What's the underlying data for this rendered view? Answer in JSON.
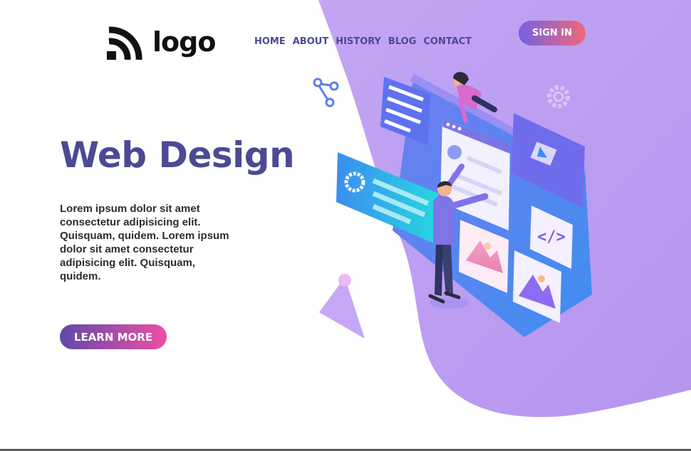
{
  "logo": {
    "text": "logo",
    "icon": "rss-arcs-icon"
  },
  "nav": {
    "items": [
      "HOME",
      "ABOUT",
      "HISTORY",
      "BLOG",
      "CONTACT"
    ]
  },
  "header": {
    "signin_label": "SIGN IN"
  },
  "hero": {
    "title": "Web Design",
    "body": "Lorem ipsum dolor sit amet consectetur adipisicing elit. Quisquam, quidem. Lorem ipsum dolor sit amet consectetur adipisicing elit. Quisquam, quidem.",
    "cta_label": "LEARN MORE"
  },
  "colors": {
    "accent": "#4b4a93",
    "purple_bg": "#c9a6f2",
    "signin_gradient": [
      "#7561e4",
      "#f0687a"
    ],
    "cta_gradient": [
      "#5f4aa8",
      "#ef4fa6"
    ]
  },
  "illustration": {
    "icons": [
      "share-icon",
      "gear-icon",
      "play-icon",
      "code-icon",
      "image-icon",
      "mountain-icon"
    ]
  }
}
